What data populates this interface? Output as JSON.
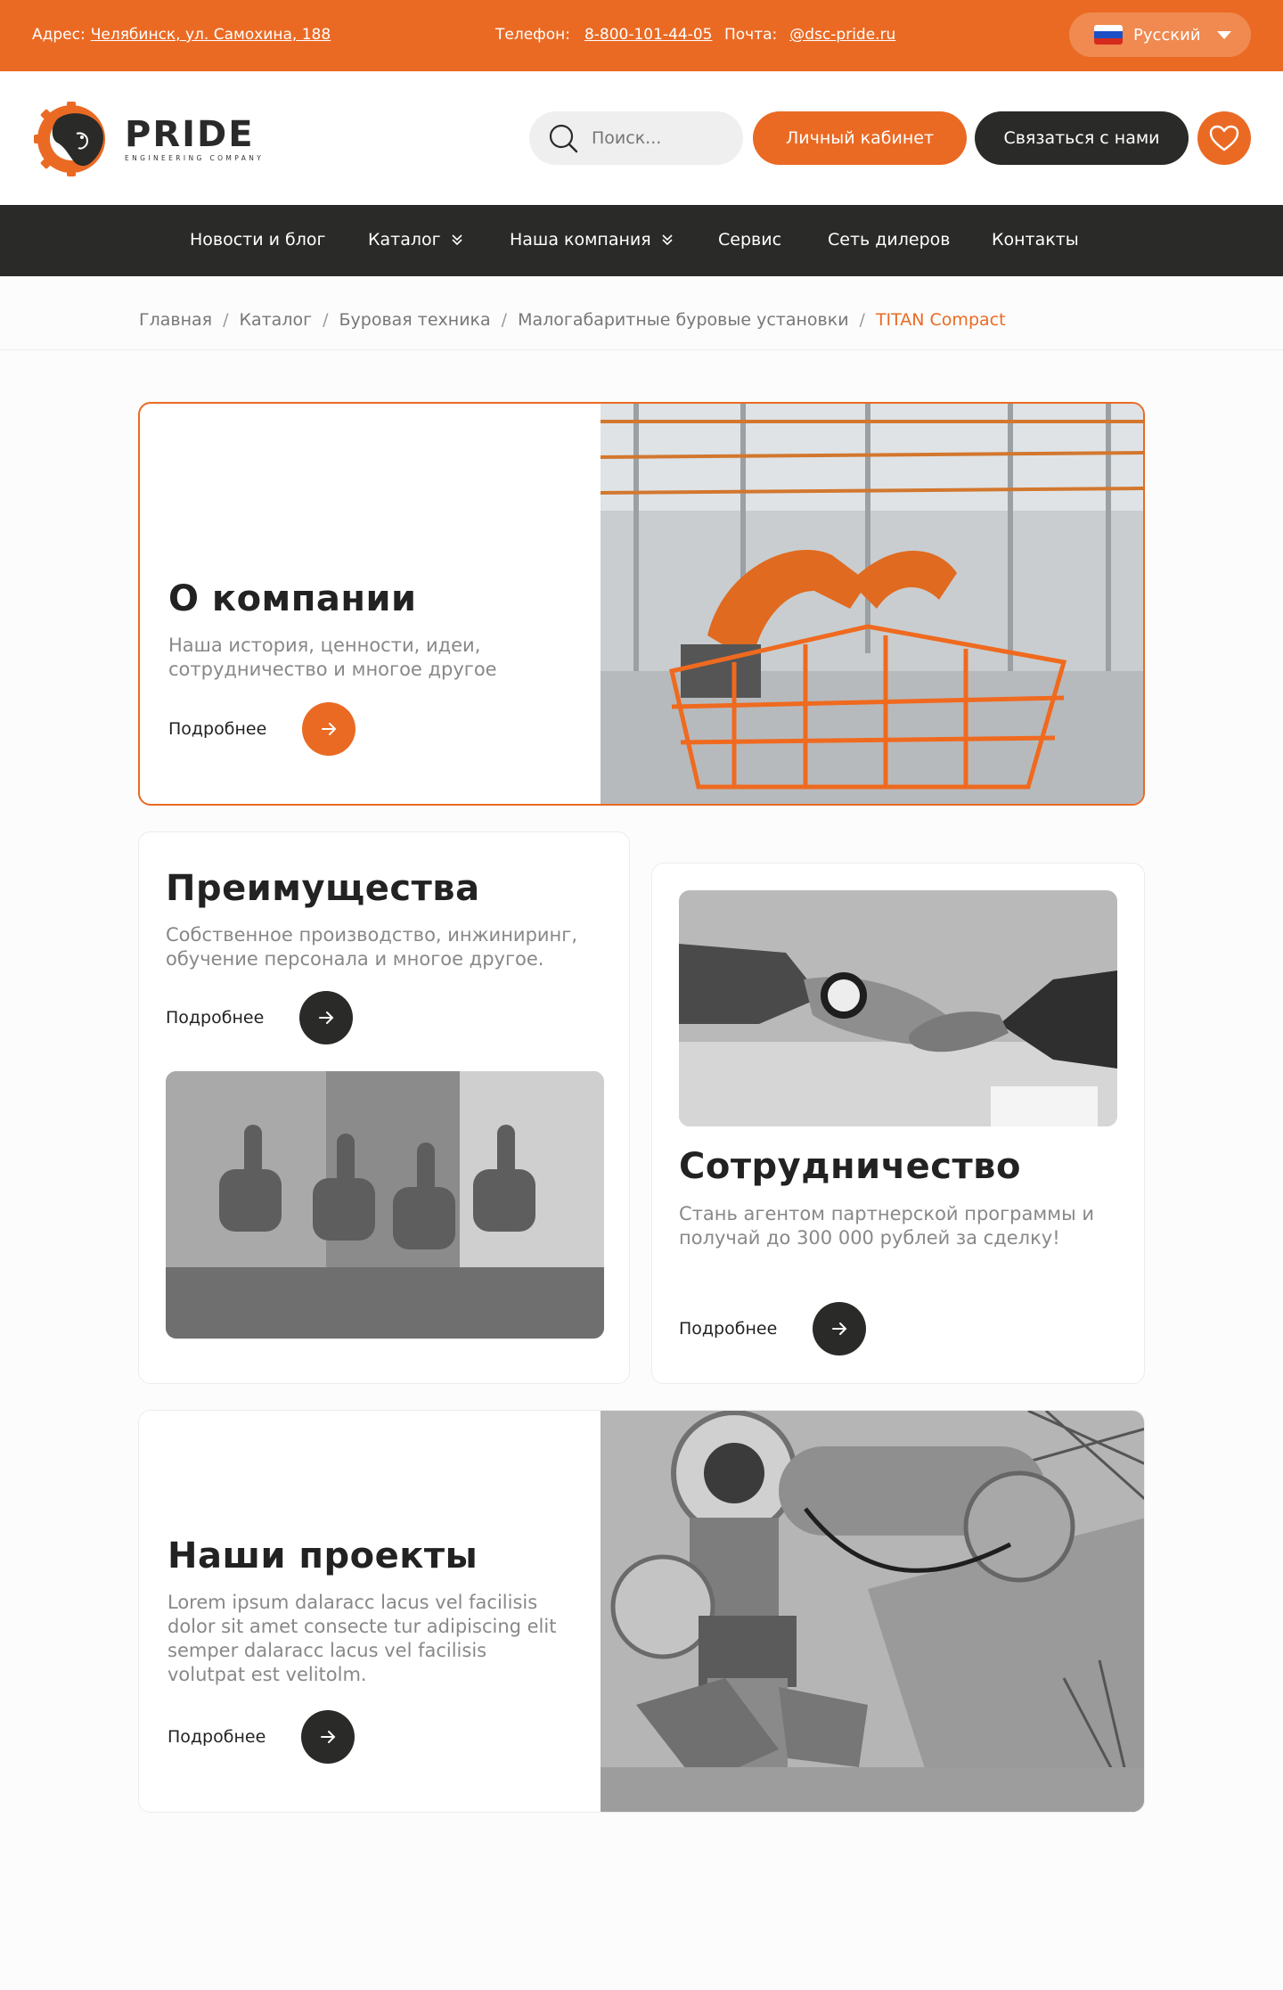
{
  "topbar": {
    "address_label": "Адрес:",
    "address_value": "Челябинск, ул. Самохина, 188",
    "phone_label": "Телефон:",
    "phone_value": "8-800-101-44-05",
    "mail_label": "Почта:",
    "mail_value": "@dsc-pride.ru",
    "language": "Русский"
  },
  "header": {
    "logo_main": "PRIDE",
    "logo_sub": "ENGINEERING COMPANY",
    "search_placeholder": "Поиск...",
    "cabinet_label": "Личный кабинет",
    "contact_label": "Связаться с нами"
  },
  "nav": {
    "items": [
      {
        "label": "Новости и блог"
      },
      {
        "label": "Каталог"
      },
      {
        "label": "Наша компания"
      },
      {
        "label": "Сервис"
      },
      {
        "label": "Сеть дилеров"
      },
      {
        "label": "Контакты"
      }
    ]
  },
  "breadcrumb": {
    "items": [
      "Главная",
      "Каталог",
      "Буровая техника",
      "Малогабаритные буровые установки"
    ],
    "current": "TITAN Compact",
    "separator": "/"
  },
  "cards": {
    "about": {
      "title": "О компании",
      "desc": "Наша история, ценности, идеи, сотрудничество и многое другое",
      "more": "Подробнее"
    },
    "advantages": {
      "title": "Преимущества",
      "desc": "Собственное производство, инжиниринг, обучение персонала и многое другое.",
      "more": "Подробнее"
    },
    "cooperation": {
      "title": "Сотрудничество",
      "desc": "Стань агентом партнерской программы и получай до 300 000 рублей за сделку!",
      "more": "Подробнее"
    },
    "projects": {
      "title": "Наши проекты",
      "desc": "Lorem ipsum dalaracc lacus vel facilisis dolor sit amet consecte tur adipiscing elit semper dalaracc lacus vel facilisis volutpat est velitolm.",
      "more": "Подробнее"
    }
  },
  "colors": {
    "accent": "#ea6a24",
    "dark": "#2a2a28",
    "muted_text": "#888888"
  },
  "icons": [
    "russia-flag-icon",
    "caret-down-icon",
    "search-icon",
    "heart-icon",
    "chevron-double-down-icon",
    "arrow-right-icon",
    "lion-gear-logo-icon"
  ]
}
